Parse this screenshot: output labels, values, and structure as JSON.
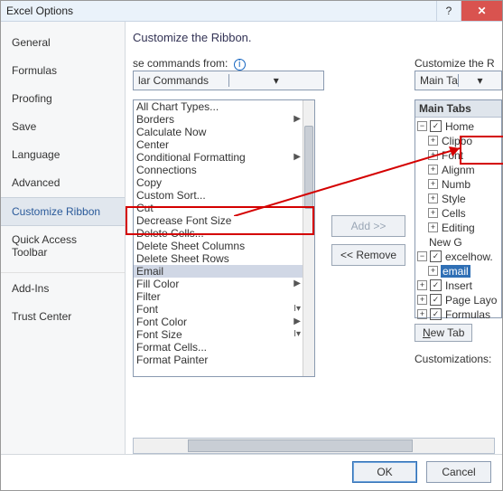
{
  "window": {
    "title": "Excel Options"
  },
  "nav": {
    "items": [
      "General",
      "Formulas",
      "Proofing",
      "Save",
      "Language",
      "Advanced",
      "Customize Ribbon",
      "Quick Access Toolbar",
      "Add-Ins",
      "Trust Center"
    ],
    "selected": "Customize Ribbon"
  },
  "header": "Customize the Ribbon.",
  "left": {
    "label": "se commands from:",
    "combo": "lar Commands",
    "commands": [
      {
        "t": "All Chart Types..."
      },
      {
        "t": "Borders",
        "sub": "▶"
      },
      {
        "t": "Calculate Now"
      },
      {
        "t": "Center"
      },
      {
        "t": "Conditional Formatting",
        "sub": "▶"
      },
      {
        "t": "Connections"
      },
      {
        "t": "Copy"
      },
      {
        "t": "Custom Sort..."
      },
      {
        "t": "Cut"
      },
      {
        "t": "Decrease Font Size"
      },
      {
        "t": "Delete Cells..."
      },
      {
        "t": "Delete Sheet Columns"
      },
      {
        "t": "Delete Sheet Rows"
      },
      {
        "t": "Email",
        "hl": true
      },
      {
        "t": "Fill Color",
        "sub": "▶"
      },
      {
        "t": "Filter"
      },
      {
        "t": "Font",
        "sub": "I▾"
      },
      {
        "t": "Font Color",
        "sub": "▶"
      },
      {
        "t": "Font Size",
        "sub": "I▾"
      },
      {
        "t": "Format Cells..."
      },
      {
        "t": "Format Painter"
      }
    ]
  },
  "mid": {
    "add": "Add >>",
    "remove": "<< Remove"
  },
  "right": {
    "label": "Customize the R",
    "combo": "Main Tabs",
    "treeTitle": "Main Tabs",
    "tree": [
      {
        "exp": "−",
        "chk": "✓",
        "t": "Home",
        "lvl": 0
      },
      {
        "exp": "+",
        "t": "Clipbo",
        "lvl": 1
      },
      {
        "exp": "+",
        "t": "Font",
        "lvl": 1
      },
      {
        "exp": "+",
        "t": "Alignm",
        "lvl": 1
      },
      {
        "exp": "+",
        "t": "Numb",
        "lvl": 1
      },
      {
        "exp": "+",
        "t": "Style",
        "lvl": 1
      },
      {
        "exp": "+",
        "t": "Cells",
        "lvl": 1
      },
      {
        "exp": "+",
        "t": "Editing",
        "lvl": 1
      },
      {
        "t": "New G",
        "lvl": 1
      },
      {
        "exp": "−",
        "chk": "✓",
        "t": "excelhow.",
        "lvl": 0
      },
      {
        "exp": "+",
        "t": "email",
        "lvl": 1,
        "sel": true
      },
      {
        "exp": "+",
        "chk": "✓",
        "t": "Insert",
        "lvl": 0
      },
      {
        "exp": "+",
        "chk": "✓",
        "t": "Page Layo",
        "lvl": 0
      },
      {
        "exp": "+",
        "chk": "✓",
        "t": "Formulas",
        "lvl": 0
      }
    ],
    "newTab": "New Tab",
    "customLabel": "Customizations:"
  },
  "footer": {
    "ok": "OK",
    "cancel": "Cancel"
  }
}
